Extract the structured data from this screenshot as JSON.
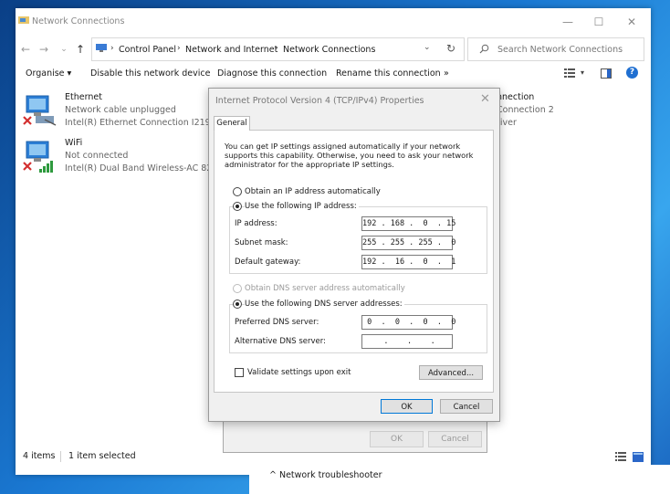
{
  "window": {
    "title": "Network Connections",
    "minimize": "—",
    "maximize": "☐",
    "close": "✕"
  },
  "address_bar": {
    "back": "←",
    "forward": "→",
    "recent": "⌄",
    "up": "↑",
    "crumbs": [
      "Control Panel",
      "Network and Internet",
      "Network Connections"
    ],
    "separator": "›",
    "dropdown": "⌄",
    "refresh": "↻",
    "search_placeholder": "Search Network Connections"
  },
  "command_bar": {
    "organise": "Organise ▾",
    "disable": "Disable this network device",
    "diagnose": "Diagnose this connection",
    "rename": "Rename this connection",
    "more": "»",
    "view_dropdown": "▾",
    "help": "?"
  },
  "connections": [
    {
      "name": "Ethernet",
      "status": "Network cable unplugged",
      "adapter": "Intel(R) Ethernet Connection I219-..."
    },
    {
      "name": "WiFi",
      "status": "Not connected",
      "adapter": "Intel(R) Dual Band Wireless-AC 82..."
    }
  ],
  "right_peek": {
    "line1": "nnection",
    "line2": "Connection 2",
    "line3": "river"
  },
  "status_bar": {
    "items": "4 items",
    "selected": "1 item selected"
  },
  "back_dialog": {
    "ok": "OK",
    "cancel": "Cancel"
  },
  "bottom_strip": {
    "text": "^     Network troubleshooter"
  },
  "dialog": {
    "title": "Internet Protocol Version 4 (TCP/IPv4) Properties",
    "close": "✕",
    "tab_general": "General",
    "intro": "You can get IP settings assigned automatically if your network supports this capability. Otherwise, you need to ask your network administrator for the appropriate IP settings.",
    "obtain_ip_auto": "Obtain an IP address automatically",
    "use_following_ip": "Use the following IP address:",
    "ip_label": "IP address:",
    "ip_value": "192 . 168 .  0  . 15",
    "subnet_label": "Subnet mask:",
    "subnet_value": "255 . 255 . 255 .  0",
    "gateway_label": "Default gateway:",
    "gateway_value": "192 .  16 .  0  .  1",
    "obtain_dns_auto": "Obtain DNS server address automatically",
    "use_following_dns": "Use the following DNS server addresses:",
    "preferred_dns_label": "Preferred DNS server:",
    "preferred_dns_value": " 0  .  0  .  0  .  0",
    "alternate_dns_label": "Alternative DNS server:",
    "alternate_dns_value": "    .    .    .   ",
    "validate_label": "Validate settings upon exit",
    "advanced": "Advanced...",
    "ok": "OK",
    "cancel": "Cancel"
  },
  "colors": {
    "accent": "#0078d7",
    "error_red": "#d32f2f",
    "signal_green": "#2e9a3e"
  }
}
